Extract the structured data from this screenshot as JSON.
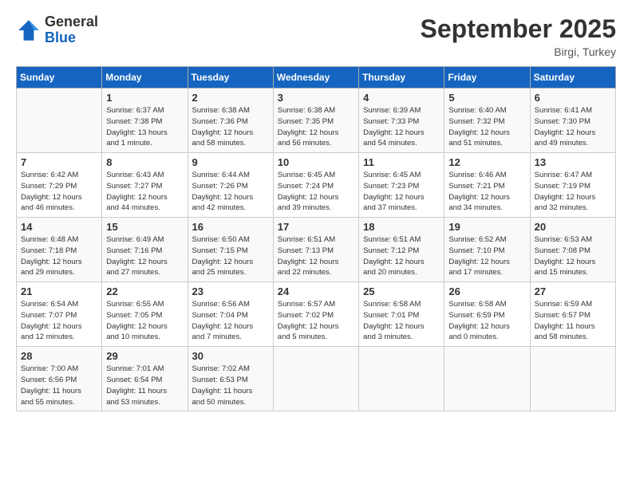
{
  "logo": {
    "general": "General",
    "blue": "Blue"
  },
  "header": {
    "month": "September 2025",
    "location": "Birgi, Turkey"
  },
  "weekdays": [
    "Sunday",
    "Monday",
    "Tuesday",
    "Wednesday",
    "Thursday",
    "Friday",
    "Saturday"
  ],
  "weeks": [
    [
      {
        "day": "",
        "info": ""
      },
      {
        "day": "1",
        "info": "Sunrise: 6:37 AM\nSunset: 7:38 PM\nDaylight: 13 hours\nand 1 minute."
      },
      {
        "day": "2",
        "info": "Sunrise: 6:38 AM\nSunset: 7:36 PM\nDaylight: 12 hours\nand 58 minutes."
      },
      {
        "day": "3",
        "info": "Sunrise: 6:38 AM\nSunset: 7:35 PM\nDaylight: 12 hours\nand 56 minutes."
      },
      {
        "day": "4",
        "info": "Sunrise: 6:39 AM\nSunset: 7:33 PM\nDaylight: 12 hours\nand 54 minutes."
      },
      {
        "day": "5",
        "info": "Sunrise: 6:40 AM\nSunset: 7:32 PM\nDaylight: 12 hours\nand 51 minutes."
      },
      {
        "day": "6",
        "info": "Sunrise: 6:41 AM\nSunset: 7:30 PM\nDaylight: 12 hours\nand 49 minutes."
      }
    ],
    [
      {
        "day": "7",
        "info": "Sunrise: 6:42 AM\nSunset: 7:29 PM\nDaylight: 12 hours\nand 46 minutes."
      },
      {
        "day": "8",
        "info": "Sunrise: 6:43 AM\nSunset: 7:27 PM\nDaylight: 12 hours\nand 44 minutes."
      },
      {
        "day": "9",
        "info": "Sunrise: 6:44 AM\nSunset: 7:26 PM\nDaylight: 12 hours\nand 42 minutes."
      },
      {
        "day": "10",
        "info": "Sunrise: 6:45 AM\nSunset: 7:24 PM\nDaylight: 12 hours\nand 39 minutes."
      },
      {
        "day": "11",
        "info": "Sunrise: 6:45 AM\nSunset: 7:23 PM\nDaylight: 12 hours\nand 37 minutes."
      },
      {
        "day": "12",
        "info": "Sunrise: 6:46 AM\nSunset: 7:21 PM\nDaylight: 12 hours\nand 34 minutes."
      },
      {
        "day": "13",
        "info": "Sunrise: 6:47 AM\nSunset: 7:19 PM\nDaylight: 12 hours\nand 32 minutes."
      }
    ],
    [
      {
        "day": "14",
        "info": "Sunrise: 6:48 AM\nSunset: 7:18 PM\nDaylight: 12 hours\nand 29 minutes."
      },
      {
        "day": "15",
        "info": "Sunrise: 6:49 AM\nSunset: 7:16 PM\nDaylight: 12 hours\nand 27 minutes."
      },
      {
        "day": "16",
        "info": "Sunrise: 6:50 AM\nSunset: 7:15 PM\nDaylight: 12 hours\nand 25 minutes."
      },
      {
        "day": "17",
        "info": "Sunrise: 6:51 AM\nSunset: 7:13 PM\nDaylight: 12 hours\nand 22 minutes."
      },
      {
        "day": "18",
        "info": "Sunrise: 6:51 AM\nSunset: 7:12 PM\nDaylight: 12 hours\nand 20 minutes."
      },
      {
        "day": "19",
        "info": "Sunrise: 6:52 AM\nSunset: 7:10 PM\nDaylight: 12 hours\nand 17 minutes."
      },
      {
        "day": "20",
        "info": "Sunrise: 6:53 AM\nSunset: 7:08 PM\nDaylight: 12 hours\nand 15 minutes."
      }
    ],
    [
      {
        "day": "21",
        "info": "Sunrise: 6:54 AM\nSunset: 7:07 PM\nDaylight: 12 hours\nand 12 minutes."
      },
      {
        "day": "22",
        "info": "Sunrise: 6:55 AM\nSunset: 7:05 PM\nDaylight: 12 hours\nand 10 minutes."
      },
      {
        "day": "23",
        "info": "Sunrise: 6:56 AM\nSunset: 7:04 PM\nDaylight: 12 hours\nand 7 minutes."
      },
      {
        "day": "24",
        "info": "Sunrise: 6:57 AM\nSunset: 7:02 PM\nDaylight: 12 hours\nand 5 minutes."
      },
      {
        "day": "25",
        "info": "Sunrise: 6:58 AM\nSunset: 7:01 PM\nDaylight: 12 hours\nand 3 minutes."
      },
      {
        "day": "26",
        "info": "Sunrise: 6:58 AM\nSunset: 6:59 PM\nDaylight: 12 hours\nand 0 minutes."
      },
      {
        "day": "27",
        "info": "Sunrise: 6:59 AM\nSunset: 6:57 PM\nDaylight: 11 hours\nand 58 minutes."
      }
    ],
    [
      {
        "day": "28",
        "info": "Sunrise: 7:00 AM\nSunset: 6:56 PM\nDaylight: 11 hours\nand 55 minutes."
      },
      {
        "day": "29",
        "info": "Sunrise: 7:01 AM\nSunset: 6:54 PM\nDaylight: 11 hours\nand 53 minutes."
      },
      {
        "day": "30",
        "info": "Sunrise: 7:02 AM\nSunset: 6:53 PM\nDaylight: 11 hours\nand 50 minutes."
      },
      {
        "day": "",
        "info": ""
      },
      {
        "day": "",
        "info": ""
      },
      {
        "day": "",
        "info": ""
      },
      {
        "day": "",
        "info": ""
      }
    ]
  ]
}
